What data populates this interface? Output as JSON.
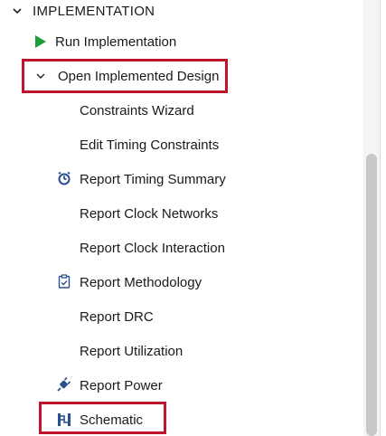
{
  "section": {
    "title": "IMPLEMENTATION",
    "expand_icon": "chevron-down-icon"
  },
  "items": [
    {
      "label": "Run Implementation",
      "icon": "play-icon",
      "color": "#1e9e3a"
    },
    {
      "label": "Open Implemented Design",
      "icon": "chevron-down-icon",
      "expanded": true,
      "highlighted": true
    },
    {
      "label": "Constraints Wizard"
    },
    {
      "label": "Edit Timing Constraints"
    },
    {
      "label": "Report Timing Summary",
      "icon": "stopwatch-icon"
    },
    {
      "label": "Report Clock Networks"
    },
    {
      "label": "Report Clock Interaction"
    },
    {
      "label": "Report Methodology",
      "icon": "clipboard-icon"
    },
    {
      "label": "Report DRC"
    },
    {
      "label": "Report Utilization"
    },
    {
      "label": "Report Power",
      "icon": "power-plug-icon"
    },
    {
      "label": "Schematic",
      "icon": "schematic-icon",
      "highlighted": true
    }
  ],
  "colors": {
    "highlight": "#c0142c",
    "icon_blue": "#2a4f8f",
    "play_green": "#1e9e3a"
  }
}
